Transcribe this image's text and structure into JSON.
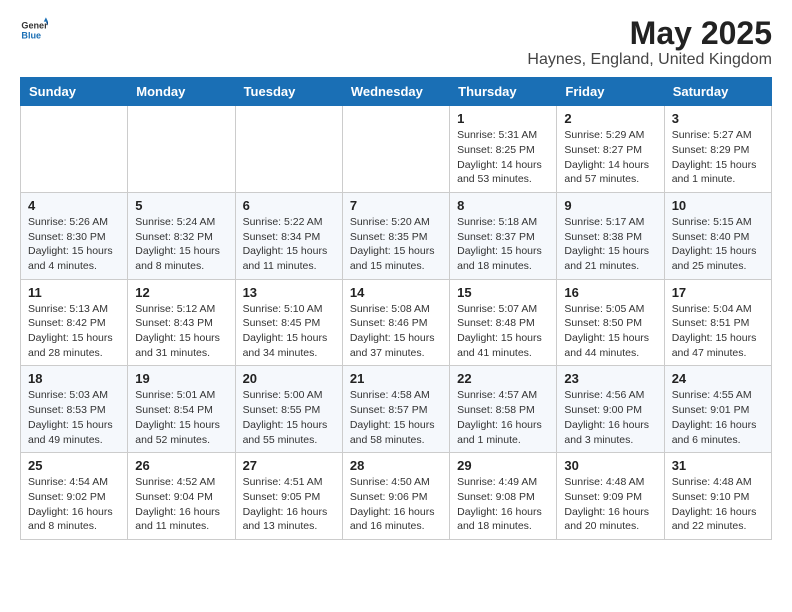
{
  "header": {
    "logo_general": "General",
    "logo_blue": "Blue",
    "month": "May 2025",
    "location": "Haynes, England, United Kingdom"
  },
  "weekdays": [
    "Sunday",
    "Monday",
    "Tuesday",
    "Wednesday",
    "Thursday",
    "Friday",
    "Saturday"
  ],
  "weeks": [
    [
      {
        "day": "",
        "info": ""
      },
      {
        "day": "",
        "info": ""
      },
      {
        "day": "",
        "info": ""
      },
      {
        "day": "",
        "info": ""
      },
      {
        "day": "1",
        "info": "Sunrise: 5:31 AM\nSunset: 8:25 PM\nDaylight: 14 hours\nand 53 minutes."
      },
      {
        "day": "2",
        "info": "Sunrise: 5:29 AM\nSunset: 8:27 PM\nDaylight: 14 hours\nand 57 minutes."
      },
      {
        "day": "3",
        "info": "Sunrise: 5:27 AM\nSunset: 8:29 PM\nDaylight: 15 hours\nand 1 minute."
      }
    ],
    [
      {
        "day": "4",
        "info": "Sunrise: 5:26 AM\nSunset: 8:30 PM\nDaylight: 15 hours\nand 4 minutes."
      },
      {
        "day": "5",
        "info": "Sunrise: 5:24 AM\nSunset: 8:32 PM\nDaylight: 15 hours\nand 8 minutes."
      },
      {
        "day": "6",
        "info": "Sunrise: 5:22 AM\nSunset: 8:34 PM\nDaylight: 15 hours\nand 11 minutes."
      },
      {
        "day": "7",
        "info": "Sunrise: 5:20 AM\nSunset: 8:35 PM\nDaylight: 15 hours\nand 15 minutes."
      },
      {
        "day": "8",
        "info": "Sunrise: 5:18 AM\nSunset: 8:37 PM\nDaylight: 15 hours\nand 18 minutes."
      },
      {
        "day": "9",
        "info": "Sunrise: 5:17 AM\nSunset: 8:38 PM\nDaylight: 15 hours\nand 21 minutes."
      },
      {
        "day": "10",
        "info": "Sunrise: 5:15 AM\nSunset: 8:40 PM\nDaylight: 15 hours\nand 25 minutes."
      }
    ],
    [
      {
        "day": "11",
        "info": "Sunrise: 5:13 AM\nSunset: 8:42 PM\nDaylight: 15 hours\nand 28 minutes."
      },
      {
        "day": "12",
        "info": "Sunrise: 5:12 AM\nSunset: 8:43 PM\nDaylight: 15 hours\nand 31 minutes."
      },
      {
        "day": "13",
        "info": "Sunrise: 5:10 AM\nSunset: 8:45 PM\nDaylight: 15 hours\nand 34 minutes."
      },
      {
        "day": "14",
        "info": "Sunrise: 5:08 AM\nSunset: 8:46 PM\nDaylight: 15 hours\nand 37 minutes."
      },
      {
        "day": "15",
        "info": "Sunrise: 5:07 AM\nSunset: 8:48 PM\nDaylight: 15 hours\nand 41 minutes."
      },
      {
        "day": "16",
        "info": "Sunrise: 5:05 AM\nSunset: 8:50 PM\nDaylight: 15 hours\nand 44 minutes."
      },
      {
        "day": "17",
        "info": "Sunrise: 5:04 AM\nSunset: 8:51 PM\nDaylight: 15 hours\nand 47 minutes."
      }
    ],
    [
      {
        "day": "18",
        "info": "Sunrise: 5:03 AM\nSunset: 8:53 PM\nDaylight: 15 hours\nand 49 minutes."
      },
      {
        "day": "19",
        "info": "Sunrise: 5:01 AM\nSunset: 8:54 PM\nDaylight: 15 hours\nand 52 minutes."
      },
      {
        "day": "20",
        "info": "Sunrise: 5:00 AM\nSunset: 8:55 PM\nDaylight: 15 hours\nand 55 minutes."
      },
      {
        "day": "21",
        "info": "Sunrise: 4:58 AM\nSunset: 8:57 PM\nDaylight: 15 hours\nand 58 minutes."
      },
      {
        "day": "22",
        "info": "Sunrise: 4:57 AM\nSunset: 8:58 PM\nDaylight: 16 hours\nand 1 minute."
      },
      {
        "day": "23",
        "info": "Sunrise: 4:56 AM\nSunset: 9:00 PM\nDaylight: 16 hours\nand 3 minutes."
      },
      {
        "day": "24",
        "info": "Sunrise: 4:55 AM\nSunset: 9:01 PM\nDaylight: 16 hours\nand 6 minutes."
      }
    ],
    [
      {
        "day": "25",
        "info": "Sunrise: 4:54 AM\nSunset: 9:02 PM\nDaylight: 16 hours\nand 8 minutes."
      },
      {
        "day": "26",
        "info": "Sunrise: 4:52 AM\nSunset: 9:04 PM\nDaylight: 16 hours\nand 11 minutes."
      },
      {
        "day": "27",
        "info": "Sunrise: 4:51 AM\nSunset: 9:05 PM\nDaylight: 16 hours\nand 13 minutes."
      },
      {
        "day": "28",
        "info": "Sunrise: 4:50 AM\nSunset: 9:06 PM\nDaylight: 16 hours\nand 16 minutes."
      },
      {
        "day": "29",
        "info": "Sunrise: 4:49 AM\nSunset: 9:08 PM\nDaylight: 16 hours\nand 18 minutes."
      },
      {
        "day": "30",
        "info": "Sunrise: 4:48 AM\nSunset: 9:09 PM\nDaylight: 16 hours\nand 20 minutes."
      },
      {
        "day": "31",
        "info": "Sunrise: 4:48 AM\nSunset: 9:10 PM\nDaylight: 16 hours\nand 22 minutes."
      }
    ]
  ]
}
